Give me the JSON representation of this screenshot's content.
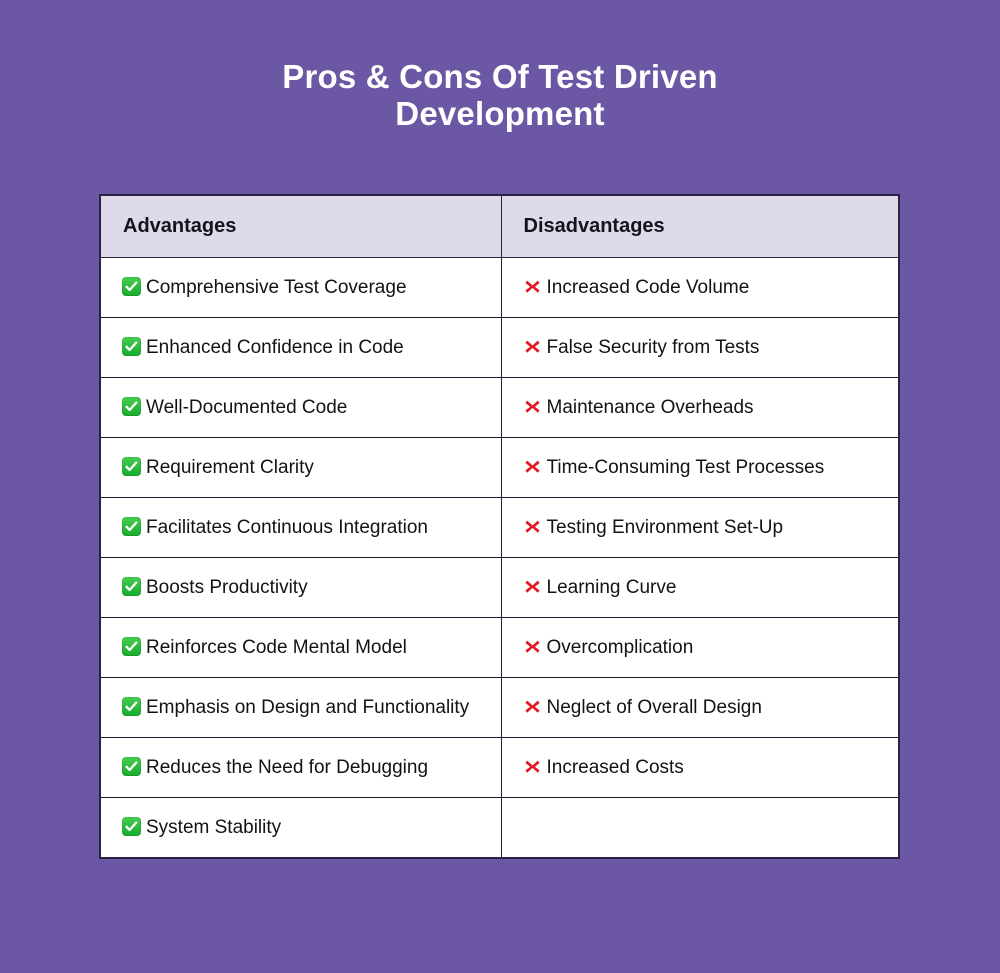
{
  "page": {
    "background_color": "#6B57A4",
    "title": "Pros & Cons Of Test Driven\nDevelopment",
    "title_color": "#FFFFFF"
  },
  "table": {
    "border_color": "#2B2140",
    "header_background": "#DEDAEA",
    "row_background": "#FFFFFF",
    "columns": [
      {
        "key": "advantages",
        "label": "Advantages",
        "icon": "check-icon",
        "icon_color": "#23B33A"
      },
      {
        "key": "disadvantages",
        "label": "Disadvantages",
        "icon": "cross-icon",
        "icon_color": "#E01B24"
      }
    ],
    "rows": [
      {
        "advantages": "Comprehensive Test Coverage",
        "disadvantages": "Increased Code Volume"
      },
      {
        "advantages": "Enhanced Confidence in Code",
        "disadvantages": "False Security from Tests"
      },
      {
        "advantages": "Well-Documented Code",
        "disadvantages": "Maintenance Overheads"
      },
      {
        "advantages": "Requirement Clarity",
        "disadvantages": "Time-Consuming Test Processes"
      },
      {
        "advantages": "Facilitates Continuous Integration",
        "disadvantages": "Testing Environment Set-Up"
      },
      {
        "advantages": "Boosts Productivity",
        "disadvantages": "Learning Curve"
      },
      {
        "advantages": "Reinforces Code Mental Model",
        "disadvantages": "Overcomplication"
      },
      {
        "advantages": "Emphasis on Design and Functionality",
        "disadvantages": "Neglect of Overall Design"
      },
      {
        "advantages": "Reduces the Need for Debugging",
        "disadvantages": "Increased Costs"
      },
      {
        "advantages": "System Stability",
        "disadvantages": ""
      }
    ]
  }
}
